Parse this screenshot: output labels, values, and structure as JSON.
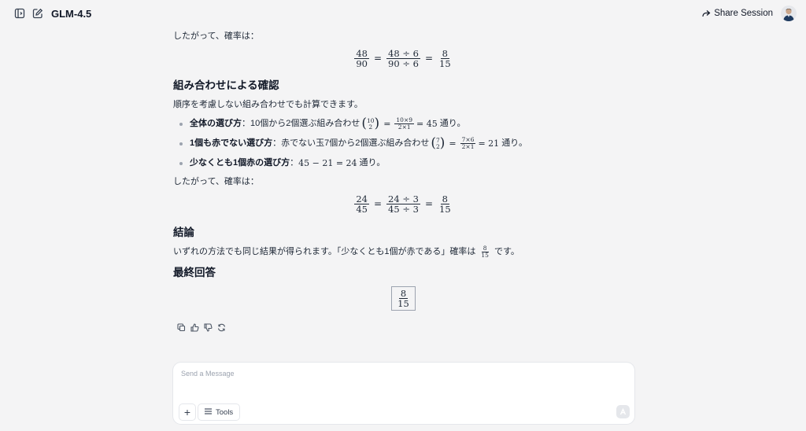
{
  "header": {
    "model_name": "GLM-4.5",
    "share_label": "Share Session",
    "icons": [
      "sidebar-toggle-icon",
      "new-chat-icon",
      "share-arrow-icon",
      "user-avatar"
    ]
  },
  "message": {
    "p1": "したがって、確率は：",
    "eq1": {
      "a_num": "48",
      "a_den": "90",
      "b_num": "48 ÷ 6",
      "b_den": "90 ÷ 6",
      "c_num": "8",
      "c_den": "15"
    },
    "h_combination": "組み合わせによる確認",
    "p2": "順序を考慮しない組み合わせでも計算できます。",
    "bullets": [
      {
        "bold": "全体の選び方",
        "text": "：10個から2個選ぶ組み合わせ",
        "binom_top": "10",
        "binom_bottom": "2",
        "f_num": "10×9",
        "f_den": "2×1",
        "result": "= 45",
        "suffix": "通り。"
      },
      {
        "bold": "1個も赤でない選び方",
        "text": "：赤でない玉7個から2個選ぶ組み合わせ",
        "binom_top": "7",
        "binom_bottom": "2",
        "f_num": "7×6",
        "f_den": "2×1",
        "result": "= 21",
        "suffix": "通り。"
      },
      {
        "bold": "少なくとも1個赤の選び方",
        "text": "：",
        "expr": "45 − 21 = 24",
        "suffix": "通り。"
      }
    ],
    "p3": "したがって、確率は：",
    "eq2": {
      "a_num": "24",
      "a_den": "45",
      "b_num": "24 ÷ 3",
      "b_den": "45 ÷ 3",
      "c_num": "8",
      "c_den": "15"
    },
    "h_conclusion": "結論",
    "p4_before": "いずれの方法でも同じ結果が得られます。「少なくとも1個が赤である」確率は",
    "p4_num": "8",
    "p4_den": "15",
    "p4_after": "です。",
    "h_final": "最終回答",
    "final_num": "8",
    "final_den": "15",
    "action_icons": [
      "copy-icon",
      "thumbs-up-icon",
      "thumbs-down-icon",
      "regenerate-icon"
    ]
  },
  "composer": {
    "placeholder": "Send a Message",
    "plus_label": "+",
    "tools_label": "Tools"
  }
}
